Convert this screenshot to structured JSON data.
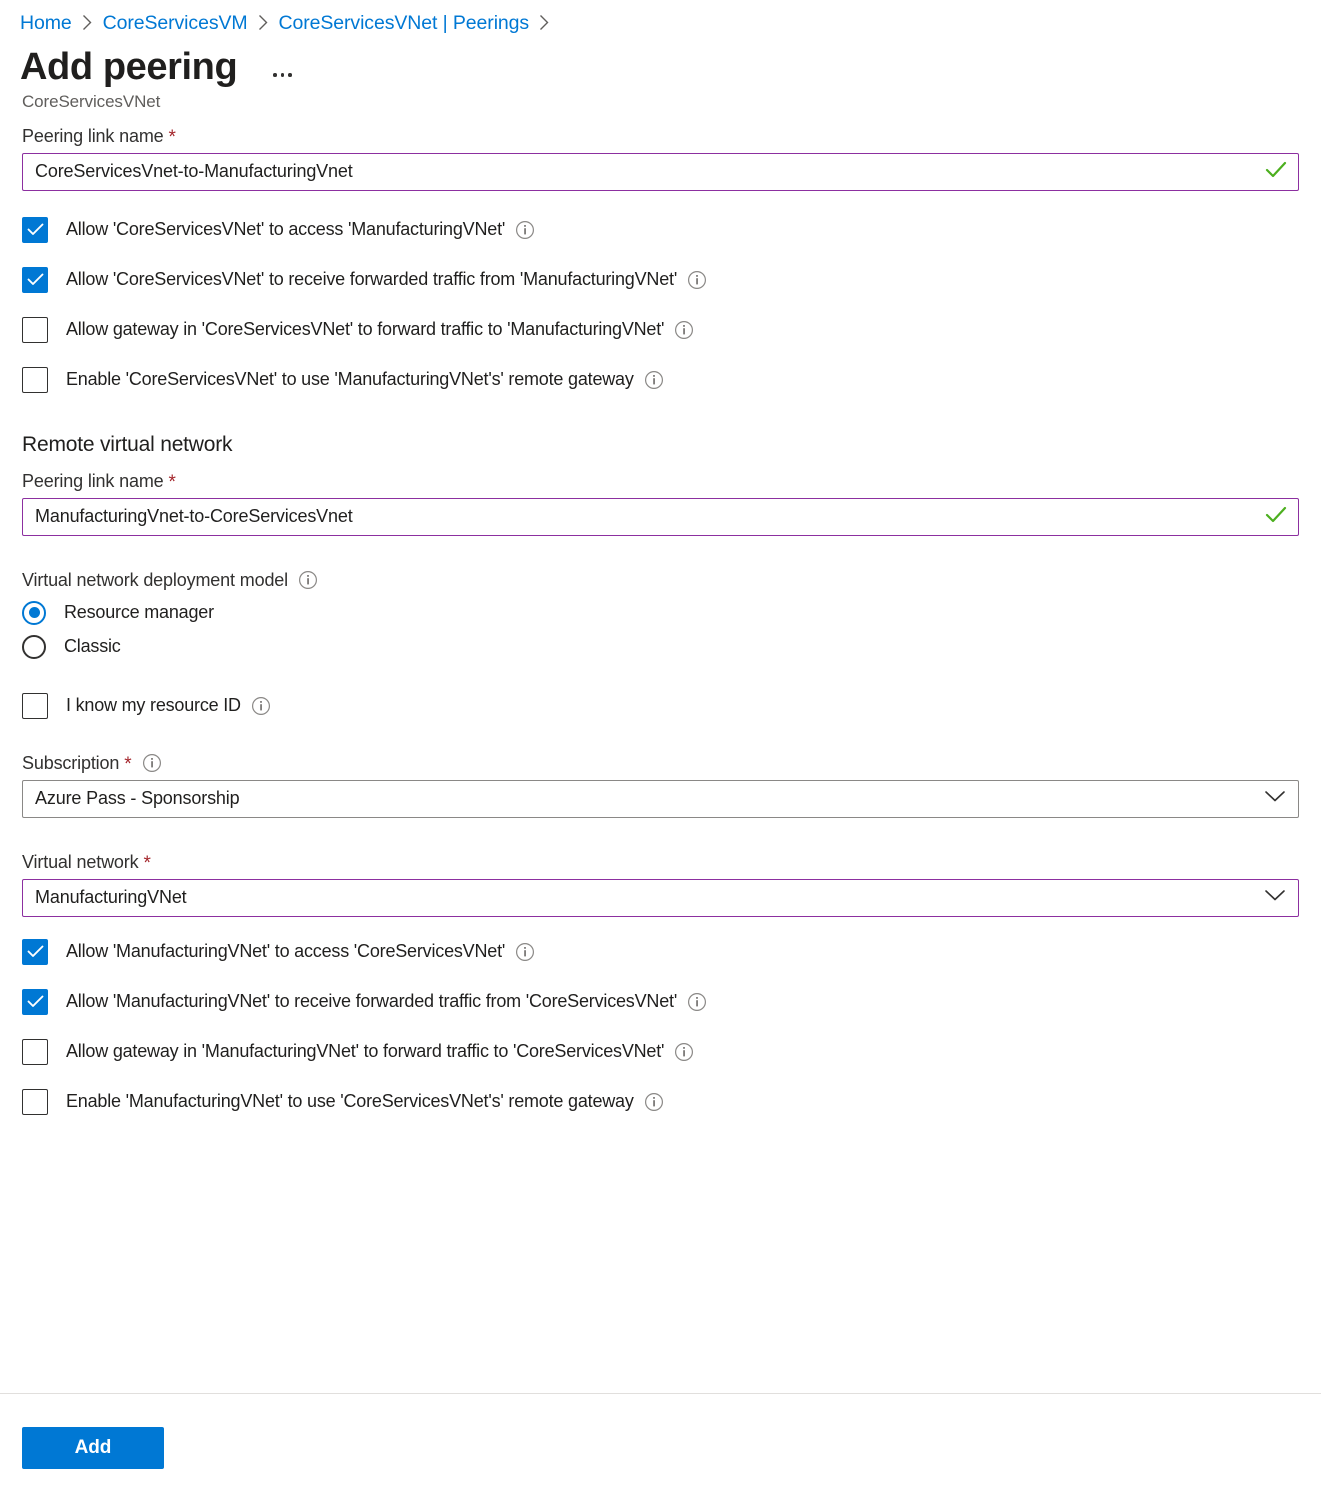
{
  "breadcrumb": {
    "items": [
      {
        "label": "Home"
      },
      {
        "label": "CoreServicesVM"
      },
      {
        "label": "CoreServicesVNet | Peerings"
      }
    ],
    "separator_icon": "chevron-right-icon"
  },
  "header": {
    "title": "Add peering",
    "subtitle": "CoreServicesVNet",
    "more_actions_icon": "ellipsis-icon"
  },
  "local": {
    "peering_link_name_label": "Peering link name",
    "peering_link_name_value": "CoreServicesVnet-to-ManufacturingVnet",
    "peering_link_name_placeholder": "Enter a name",
    "required_marker": "*",
    "validation_icon": "green-check-icon",
    "checkboxes": [
      {
        "label": "Allow 'CoreServicesVNet' to access 'ManufacturingVNet'",
        "checked": true,
        "info_icon": "info-icon"
      },
      {
        "label": "Allow 'CoreServicesVNet' to receive forwarded traffic from 'ManufacturingVNet'",
        "checked": true,
        "info_icon": "info-icon"
      },
      {
        "label": "Allow gateway in 'CoreServicesVNet' to forward traffic to 'ManufacturingVNet'",
        "checked": false,
        "info_icon": "info-icon"
      },
      {
        "label": "Enable 'CoreServicesVNet' to use 'ManufacturingVNet's' remote gateway",
        "checked": false,
        "info_icon": "info-icon"
      }
    ]
  },
  "remote": {
    "section_heading": "Remote virtual network",
    "peering_link_name_label": "Peering link name",
    "peering_link_name_value": "ManufacturingVnet-to-CoreServicesVnet",
    "peering_link_name_placeholder": "Enter a name",
    "required_marker": "*",
    "validation_icon": "green-check-icon",
    "deployment_model_label": "Virtual network deployment model",
    "deployment_model_info_icon": "info-icon",
    "deployment_model_options": [
      {
        "label": "Resource manager",
        "selected": true
      },
      {
        "label": "Classic",
        "selected": false
      }
    ],
    "know_resource_id": {
      "label": "I know my resource ID",
      "checked": false,
      "info_icon": "info-icon"
    },
    "subscription_label": "Subscription",
    "subscription_value": "Azure Pass - Sponsorship",
    "subscription_info_icon": "info-icon",
    "subscription_chevron_icon": "chevron-down-icon",
    "virtual_network_label": "Virtual network",
    "virtual_network_value": "ManufacturingVNet",
    "virtual_network_chevron_icon": "chevron-down-icon",
    "checkboxes": [
      {
        "label": "Allow 'ManufacturingVNet' to access 'CoreServicesVNet'",
        "checked": true,
        "info_icon": "info-icon"
      },
      {
        "label": "Allow 'ManufacturingVNet' to receive forwarded traffic from 'CoreServicesVNet'",
        "checked": true,
        "info_icon": "info-icon"
      },
      {
        "label": "Allow gateway in 'ManufacturingVNet' to forward traffic to 'CoreServicesVNet'",
        "checked": false,
        "info_icon": "info-icon"
      },
      {
        "label": "Enable 'ManufacturingVNet' to use 'CoreServicesVNet's' remote gateway",
        "checked": false,
        "info_icon": "info-icon"
      }
    ]
  },
  "footer": {
    "add_label": "Add"
  },
  "colors": {
    "accent": "#0078d4",
    "link": "#0078d4",
    "required": "#a4262c",
    "focus_border": "#8c2fa0",
    "valid_check": "#498205",
    "neutral_border": "#8a8886",
    "subtitle": "#605e5c"
  }
}
